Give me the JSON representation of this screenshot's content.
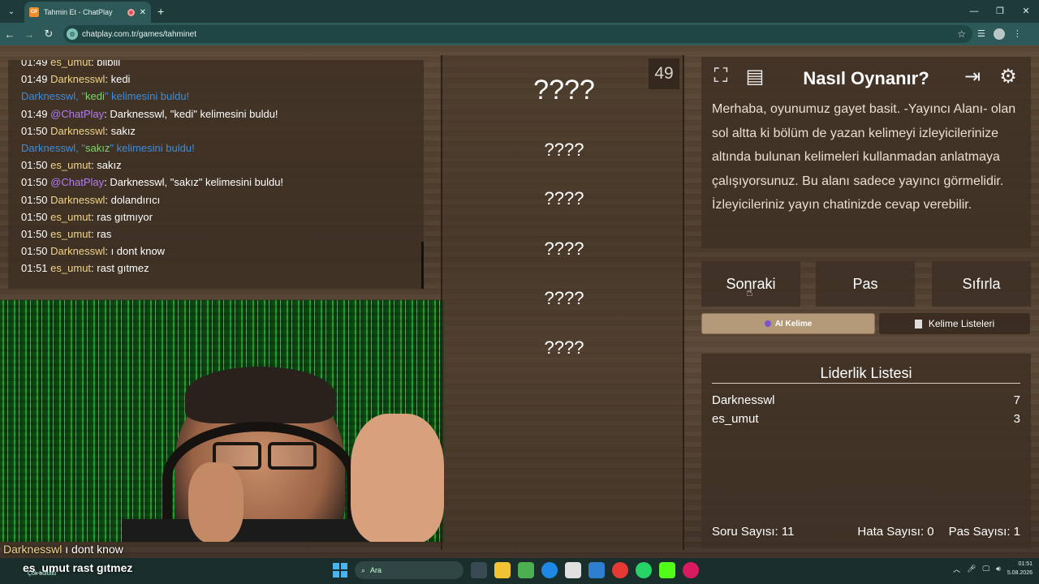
{
  "browser": {
    "tab_title": "Tahmin Et - ChatPlay",
    "favicon_text": "CP",
    "url": "chatplay.com.tr/games/tahminet"
  },
  "chat": {
    "lines": [
      {
        "time": "01:49",
        "user": "es_umut",
        "msg": ": bilbili",
        "kind": "es"
      },
      {
        "time": "01:49",
        "user": "Darknesswl",
        "msg": ": kedi",
        "kind": "dark"
      },
      {
        "pre": "Darknesswl, \"",
        "word": "kedi",
        "post": "\" kelimesini buldu!",
        "kind": "sys"
      },
      {
        "time": "01:49",
        "user": "@ChatPlay",
        "msg": ": Darknesswl, \"kedi\" kelimesini buldu!",
        "kind": "cp"
      },
      {
        "time": "01:50",
        "user": "Darknesswl",
        "msg": ": sakız",
        "kind": "dark"
      },
      {
        "pre": "Darknesswl, \"",
        "word": "sakız",
        "post": "\" kelimesini buldu!",
        "kind": "sys"
      },
      {
        "time": "01:50",
        "user": "es_umut",
        "msg": ": sakız",
        "kind": "es"
      },
      {
        "time": "01:50",
        "user": "@ChatPlay",
        "msg": ": Darknesswl, \"sakız\" kelimesini buldu!",
        "kind": "cp"
      },
      {
        "time": "01:50",
        "user": "Darknesswl",
        "msg": ": dolandırıcı",
        "kind": "dark"
      },
      {
        "time": "01:50",
        "user": "es_umut",
        "msg": ": ras gıtmıyor",
        "kind": "es"
      },
      {
        "time": "01:50",
        "user": "es_umut",
        "msg": ": ras",
        "kind": "es"
      },
      {
        "time": "01:50",
        "user": "Darknesswl",
        "msg": ": ı dont know",
        "kind": "dark"
      },
      {
        "time": "01:51",
        "user": "es_umut",
        "msg": ": rast gıtmez",
        "kind": "es"
      }
    ]
  },
  "overlay": {
    "line1_user": "Darknesswl",
    "line1_msg": " ı dont know",
    "line2": "es_umut  rast gıtmez",
    "weather": "Çok bulutlu"
  },
  "words": {
    "counter": "49",
    "slots": [
      "????",
      "????",
      "????",
      "????",
      "????",
      "????"
    ]
  },
  "howto": {
    "title": "Nasıl Oynanır?",
    "body": "Merhaba, oyunumuz gayet basit. -Yayıncı Alanı- olan sol altta ki bölüm de yazan kelimeyi izleyicilerinize altında bulunan kelimeleri kullanmadan anlatmaya çalışıyorsunuz. Bu alanı sadece yayıncı görmelidir. İzleyicileriniz yayın chatinizde cevap verebilir."
  },
  "actions": {
    "next": "Sonraki",
    "pass": "Pas",
    "reset": "Sıfırla"
  },
  "mode_tabs": {
    "ai": "AI Kelime",
    "lists": "Kelime Listeleri"
  },
  "leaderboard": {
    "title": "Liderlik Listesi",
    "rows": [
      {
        "name": "Darknesswl",
        "score": "7"
      },
      {
        "name": "es_umut",
        "score": "3"
      }
    ],
    "questions": "Soru Sayısı: 11",
    "errors": "Hata Sayısı: 0",
    "passes": "Pas Sayısı: 1"
  },
  "taskbar": {
    "search": "Ara",
    "time": "01:51",
    "date": "5.08.2026"
  },
  "colors": {
    "user": "#f0d58a",
    "chatplay": "#b37df0",
    "system": "#3f8bd6",
    "found_word": "#7fd46e"
  }
}
